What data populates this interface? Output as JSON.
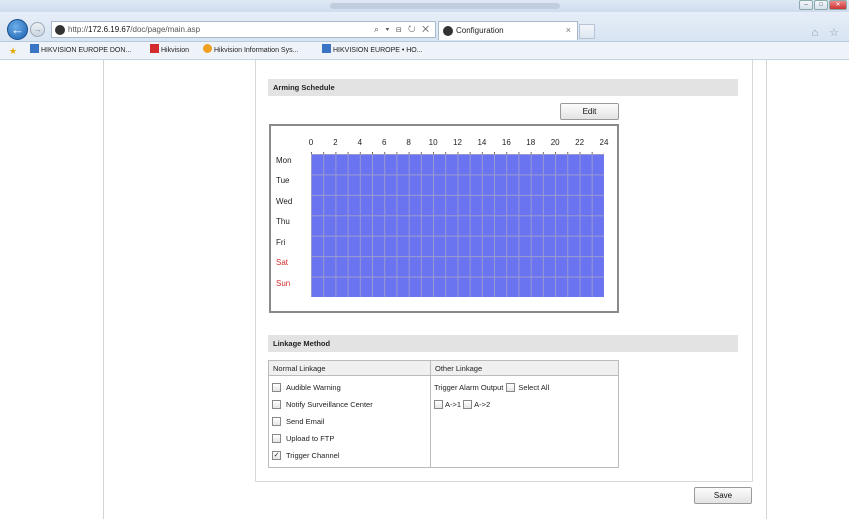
{
  "browser": {
    "url_prefix": "http://",
    "url_host": "172.6.19.67",
    "url_path": "/doc/page/main.asp",
    "address_controls": "⌕ ▾ ⊟ ↻ ✕",
    "tab_title": "Configuration",
    "tab_close": "×",
    "back_label": "←",
    "forward_label": "→",
    "right_icons": "⌂ ☆"
  },
  "favorites": [
    {
      "label": "HIKVISION EUROPE DON...",
      "icon_color": "#3a74c4"
    },
    {
      "label": "Hikvision",
      "icon_color": "#d32b2b"
    },
    {
      "label": "Hikvision Information Sys...",
      "icon_color": "#f0a020"
    },
    {
      "label": "HIKVISION EUROPE • HO...",
      "icon_color": "#3a74c4"
    }
  ],
  "arming": {
    "section_title": "Arming Schedule",
    "edit_label": "Edit",
    "hours": [
      "0",
      "2",
      "4",
      "6",
      "8",
      "10",
      "12",
      "14",
      "16",
      "18",
      "20",
      "22",
      "24"
    ],
    "days": [
      "Mon",
      "Tue",
      "Wed",
      "Thu",
      "Fri",
      "Sat",
      "Sun"
    ],
    "fill_color": "#6a74f0",
    "weekend_color": "#d32b2b"
  },
  "linkage": {
    "section_title": "Linkage Method",
    "normal_header": "Normal Linkage",
    "other_header": "Other Linkage",
    "normal_items": [
      {
        "label": "Audible Warning",
        "checked": false
      },
      {
        "label": "Notify Surveillance Center",
        "checked": false
      },
      {
        "label": "Send Email",
        "checked": false
      },
      {
        "label": "Upload to FTP",
        "checked": false
      },
      {
        "label": "Trigger Channel",
        "checked": true
      }
    ],
    "trigger_output_label": "Trigger Alarm Output",
    "select_all_label": "Select All",
    "outputs": [
      {
        "label": "A->1",
        "checked": false
      },
      {
        "label": "A->2",
        "checked": false
      }
    ]
  },
  "save_label": "Save"
}
